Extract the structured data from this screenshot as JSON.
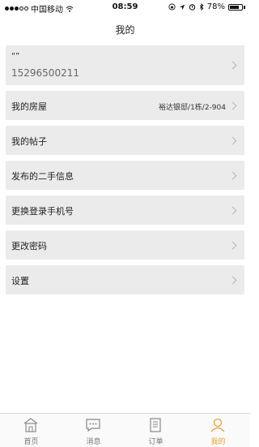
{
  "status_bar": {
    "carrier": "中国移动",
    "time": "08:59",
    "battery": "78%",
    "battery_level": 0.78
  },
  "nav": {
    "title": "我的"
  },
  "profile": {
    "nickname": "“”",
    "phone": "15296500211"
  },
  "menu": [
    {
      "label": "我的房屋",
      "value": "裕达银邸/1栋/2-904"
    },
    {
      "label": "我的帖子"
    },
    {
      "label": "发布的二手信息"
    },
    {
      "label": "更换登录手机号"
    },
    {
      "label": "更改密码"
    },
    {
      "label": "设置"
    }
  ],
  "tabbar": {
    "tabs": [
      {
        "label": "首页",
        "icon": "home-icon"
      },
      {
        "label": "消息",
        "icon": "message-icon"
      },
      {
        "label": "订单",
        "icon": "order-icon"
      },
      {
        "label": "我的",
        "icon": "user-icon"
      }
    ],
    "active_color": "#f0a030",
    "inactive_color": "#888888"
  }
}
